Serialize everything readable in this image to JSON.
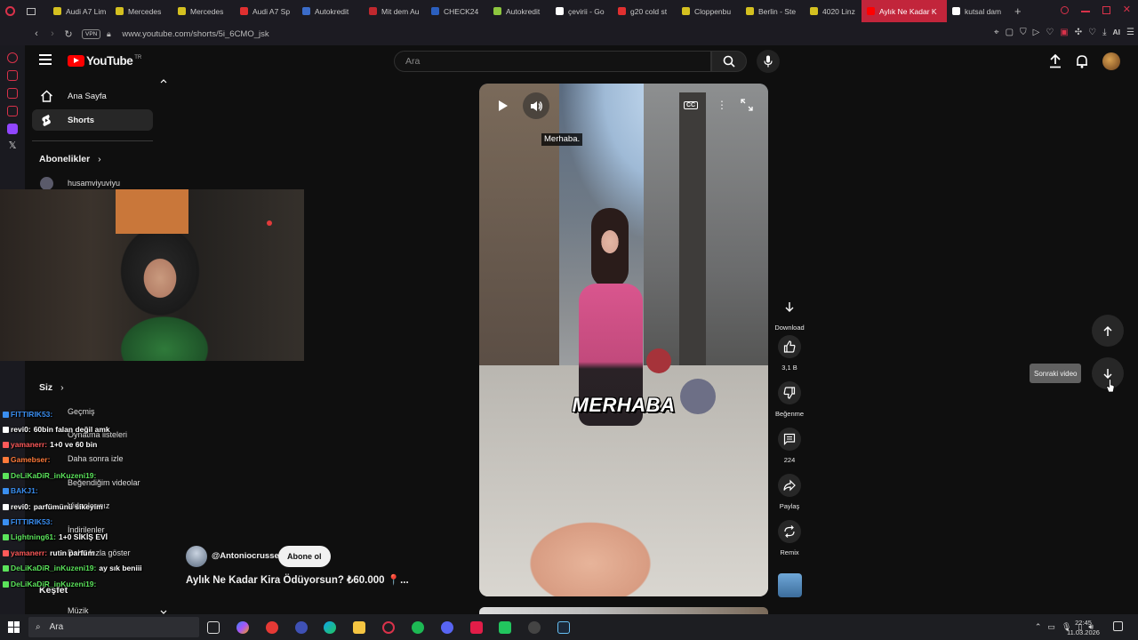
{
  "browser": {
    "tabs": [
      {
        "label": "Audi A7 Lim",
        "color": "#d4c020"
      },
      {
        "label": "Mercedes",
        "color": "#d4c020"
      },
      {
        "label": "Mercedes",
        "color": "#d4c020"
      },
      {
        "label": "Audi A7 Sp",
        "color": "#e03030"
      },
      {
        "label": "Autokredit",
        "color": "#3b6cc9"
      },
      {
        "label": "Mit dem Au",
        "color": "#c0282e"
      },
      {
        "label": "CHECK24",
        "color": "#2b5fbf"
      },
      {
        "label": "Autokredit",
        "color": "#8dc63f"
      },
      {
        "label": "çevirii - Go",
        "color": "#ffffff"
      },
      {
        "label": "g20 cold st",
        "color": "#e03030"
      },
      {
        "label": "Cloppenbu",
        "color": "#d4c020"
      },
      {
        "label": "Berlin - Ste",
        "color": "#d4c020"
      },
      {
        "label": "4020 Linz",
        "color": "#d4c020"
      },
      {
        "label": "Aylık Ne Kadar K",
        "color": "#ff0000",
        "active": true
      },
      {
        "label": "kutsal dam",
        "color": "#ffffff"
      }
    ],
    "url": "www.youtube.com/shorts/5i_6CMO_jsk",
    "vpn_label": "VPN",
    "ai_label": "AI"
  },
  "youtube": {
    "logo_text": "YouTube",
    "logo_tr": "TR",
    "search_placeholder": "Ara"
  },
  "sidebar": {
    "home": "Ana Sayfa",
    "shorts": "Shorts",
    "subscriptions_heading": "Abonelikler",
    "subscription_channel": "husamviyuviyu",
    "you_heading": "Siz",
    "you_items": [
      "Geçmiş",
      "Oynatma listeleri",
      "Daha sonra izle",
      "Beğendiğim videolar",
      "Videolarınız",
      "İndirilenler",
      "Daha fazla göster"
    ],
    "explore_heading": "Keşfet",
    "music": "Müzik"
  },
  "chat": [
    {
      "user": "FITTIRIK53:",
      "msg": "",
      "user_color": "#3a8ef0"
    },
    {
      "user": "revi0:",
      "msg": "60bin falan değil amk",
      "user_color": "#ffffff"
    },
    {
      "user": "yamanerr:",
      "msg": "1+0 ve 60 bin",
      "user_color": "#ff5a5a"
    },
    {
      "user": "Gamebser:",
      "msg": "",
      "user_color": "#ff7a3a"
    },
    {
      "user": "DeLiKaDiR_inKuzeni19:",
      "msg": "",
      "user_color": "#5be35b"
    },
    {
      "user": "BAKJ1:",
      "msg": "",
      "user_color": "#3a8ef0"
    },
    {
      "user": "revi0:",
      "msg": "parfümünü sikeyim",
      "user_color": "#ffffff"
    },
    {
      "user": "FITTIRIK53:",
      "msg": "",
      "user_color": "#3a8ef0"
    },
    {
      "user": "Lightning61:",
      "msg": "1+0 SİKİŞ EVİ",
      "user_color": "#5be35b"
    },
    {
      "user": "yamanerr:",
      "msg": "rutin parfüm",
      "user_color": "#ff5a5a"
    },
    {
      "user": "DeLiKaDiR_inKuzeni19:",
      "msg": "ay sık beniii",
      "user_color": "#5be35b"
    },
    {
      "user": "DeLiKaDiR_inKuzeni19:",
      "msg": "",
      "user_color": "#5be35b"
    }
  ],
  "video": {
    "subtitle_top": "Merhaba.",
    "caption": "MERHABA",
    "cc_label": "CC",
    "channel": "@Antoniocrusse",
    "subscribe": "Abone ol",
    "title": "Aylık Ne Kadar Kira Ödüyorsun? ₺60.000 📍..."
  },
  "actions": {
    "download": "Download",
    "likes": "3,1 B",
    "dislike": "Beğenme",
    "comments": "224",
    "share": "Paylaş",
    "remix": "Remix"
  },
  "navigation": {
    "next_tooltip": "Sonraki video"
  },
  "taskbar": {
    "search_placeholder": "Ara",
    "time": "22:45",
    "date": "11.03.2026"
  }
}
